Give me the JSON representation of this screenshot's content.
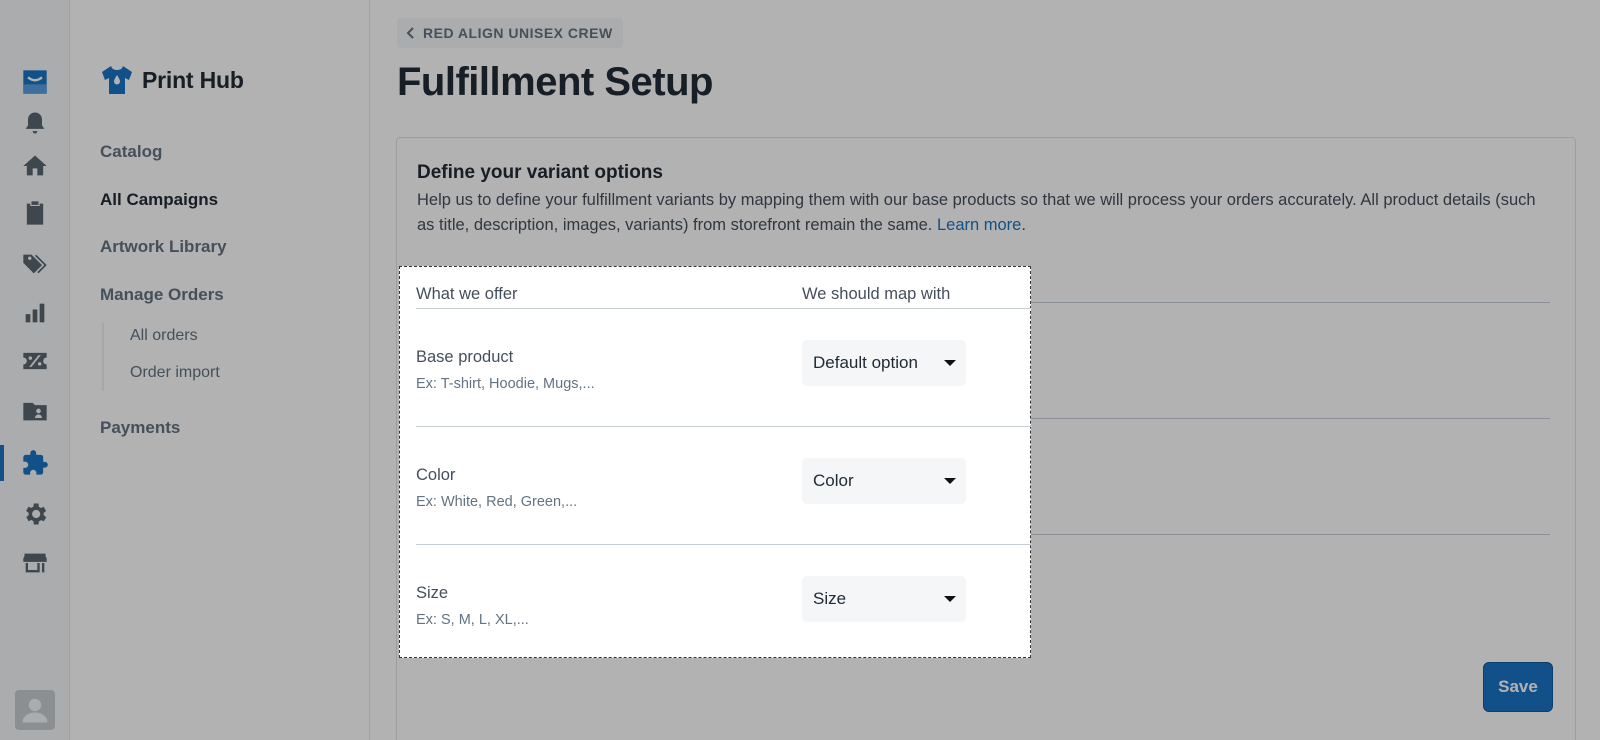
{
  "rail": {
    "items": [
      {
        "icon": "brand-inbox-icon"
      },
      {
        "icon": "bell-icon"
      },
      {
        "icon": "home-icon"
      },
      {
        "icon": "clipboard-icon"
      },
      {
        "icon": "tags-icon"
      },
      {
        "icon": "bar-chart-icon"
      },
      {
        "icon": "discount-icon"
      },
      {
        "icon": "folder-user-icon"
      },
      {
        "icon": "puzzle-icon"
      },
      {
        "icon": "gear-icon"
      },
      {
        "icon": "store-icon"
      }
    ],
    "active_icon": "puzzle-icon",
    "avatar_icon": "user-avatar-icon"
  },
  "sidebar": {
    "brand": "Print Hub",
    "nav": {
      "catalog": "Catalog",
      "all_campaigns": "All Campaigns",
      "artwork_library": "Artwork Library",
      "manage_orders": "Manage Orders",
      "all_orders": "All orders",
      "order_import": "Order import",
      "payments": "Payments"
    },
    "active": "All Campaigns"
  },
  "header": {
    "back_label": "RED ALIGN UNISEX CREW",
    "title": "Fulfillment Setup"
  },
  "card": {
    "title": "Define your variant options",
    "description": "Help us to define your fulfillment variants by mapping them with our base products so that we will process your orders accurately. All product details (such as title, description, images, variants) from storefront remain the same.",
    "learn_more": "Learn more",
    "period": "."
  },
  "mapping": {
    "col_offer": "What we offer",
    "col_map": "We should map with",
    "rows": [
      {
        "label": "Base product",
        "hint": "Ex: T-shirt, Hoodie, Mugs,...",
        "selected": "Default option"
      },
      {
        "label": "Color",
        "hint": "Ex: White, Red, Green,...",
        "selected": "Color"
      },
      {
        "label": "Size",
        "hint": "Ex: S, M, L, XL,...",
        "selected": "Size"
      }
    ]
  },
  "actions": {
    "save": "Save"
  },
  "colors": {
    "accent": "#1973c3",
    "overlay": "rgba(0,0,0,0.3)"
  }
}
